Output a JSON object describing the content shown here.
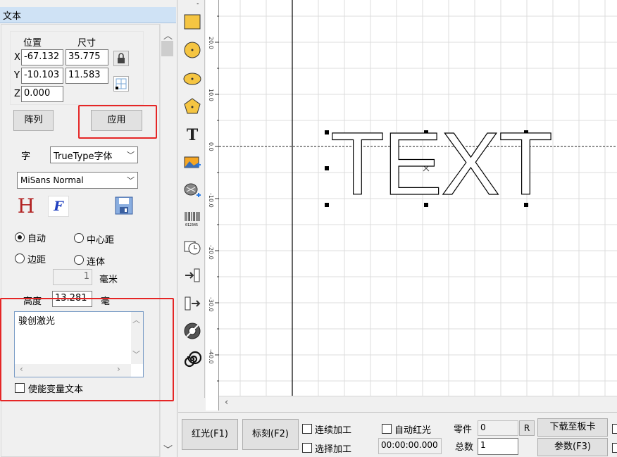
{
  "panel": {
    "title": "文本",
    "pos_label": "位置",
    "size_label": "尺寸",
    "x_label": "X",
    "y_label": "Y",
    "z_label": "Z",
    "x_value": "-67.132",
    "y_value": "-10.103",
    "z_value": "0.000",
    "width_value": "35.775",
    "height_value": "11.583",
    "array_button": "阵列",
    "apply_button": "应用",
    "font_label": "字",
    "font_type": "TrueType字体",
    "font_name": "MiSans Normal",
    "font_h_icon": "H",
    "font_f_icon": "F",
    "radio_auto": "自动",
    "radio_center": "中心距",
    "radio_margin": "边距",
    "radio_joined": "连体",
    "spacing_value": "1",
    "spacing_unit": "毫米",
    "height_label": "高度",
    "height_field": "13.281",
    "height_unit": "毫",
    "text_content": "骏创激光",
    "variable_text_label": "使能变量文本"
  },
  "canvas": {
    "text_object": "TEXT",
    "ruler_ticks": [
      "20.0",
      "10.0",
      "0.0",
      "-10.0",
      "-20.0",
      "-30.0",
      "-40.0"
    ]
  },
  "toolbar": {
    "tools": [
      "rectangle-icon",
      "circle-icon",
      "ellipse-icon",
      "polygon-icon",
      "text-tool-icon",
      "bitmap-icon",
      "vector-file-icon",
      "barcode-icon",
      "timer-icon",
      "input-port-icon",
      "output-port-icon",
      "encoder-icon",
      "spiral-icon"
    ]
  },
  "bottombar": {
    "red_light_button": "红光(F1)",
    "mark_button": "标刻(F2)",
    "continuous_label": "连续加工",
    "select_process_label": "选择加工",
    "auto_red_label": "自动红光",
    "time_value": "00:00:00.000",
    "parts_label": "零件",
    "parts_value": "0",
    "reset_button": "R",
    "total_label": "总数",
    "total_value": "1",
    "download_button": "下载至板卡",
    "params_button": "参数(F3)"
  },
  "colors": {
    "highlight": "#e52626",
    "title_bar": "#cfe2f5",
    "icon_fill": "#f5c542"
  }
}
